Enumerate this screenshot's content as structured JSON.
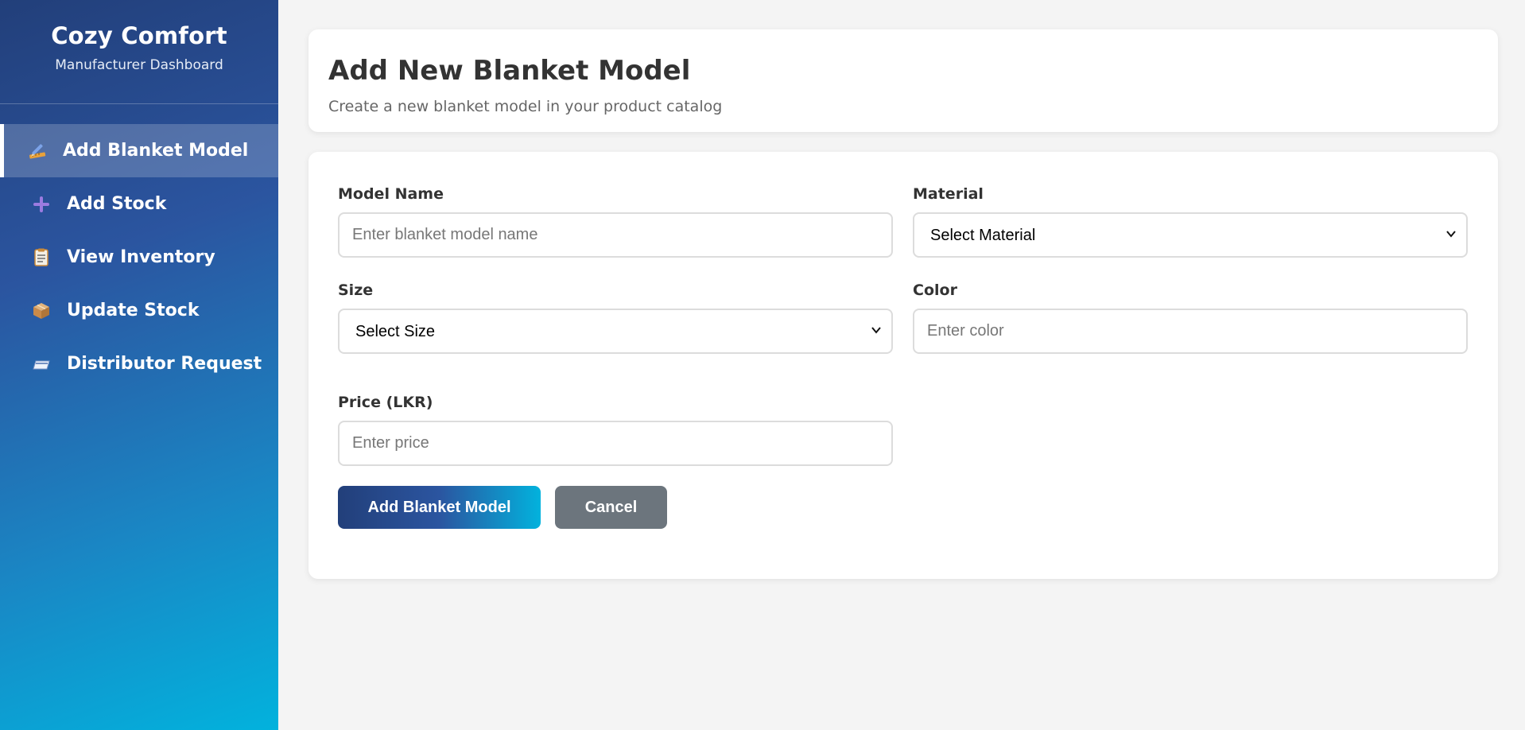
{
  "brand": {
    "title": "Cozy Comfort",
    "subtitle": "Manufacturer Dashboard"
  },
  "sidebar": {
    "items": [
      {
        "label": "Add Blanket Model",
        "icon": "pencil-ruler-icon",
        "active": true
      },
      {
        "label": "Add Stock",
        "icon": "plus-icon",
        "active": false
      },
      {
        "label": "View Inventory",
        "icon": "clipboard-icon",
        "active": false
      },
      {
        "label": "Update Stock",
        "icon": "package-icon",
        "active": false
      },
      {
        "label": "Distributor Request",
        "icon": "card-icon",
        "active": false
      }
    ]
  },
  "header": {
    "title": "Add New Blanket Model",
    "subtitle": "Create a new blanket model in your product catalog"
  },
  "form": {
    "model_name": {
      "label": "Model Name",
      "placeholder": "Enter blanket model name"
    },
    "material": {
      "label": "Material",
      "selected": "Select Material"
    },
    "size": {
      "label": "Size",
      "selected": "Select Size"
    },
    "color": {
      "label": "Color",
      "placeholder": "Enter color"
    },
    "price": {
      "label": "Price (LKR)",
      "placeholder": "Enter price"
    },
    "submit_label": "Add Blanket Model",
    "cancel_label": "Cancel"
  },
  "colors": {
    "sidebar_start": "#223f7a",
    "sidebar_end": "#02b2dd",
    "cancel_button": "#6c757d",
    "background": "#f4f4f4"
  }
}
